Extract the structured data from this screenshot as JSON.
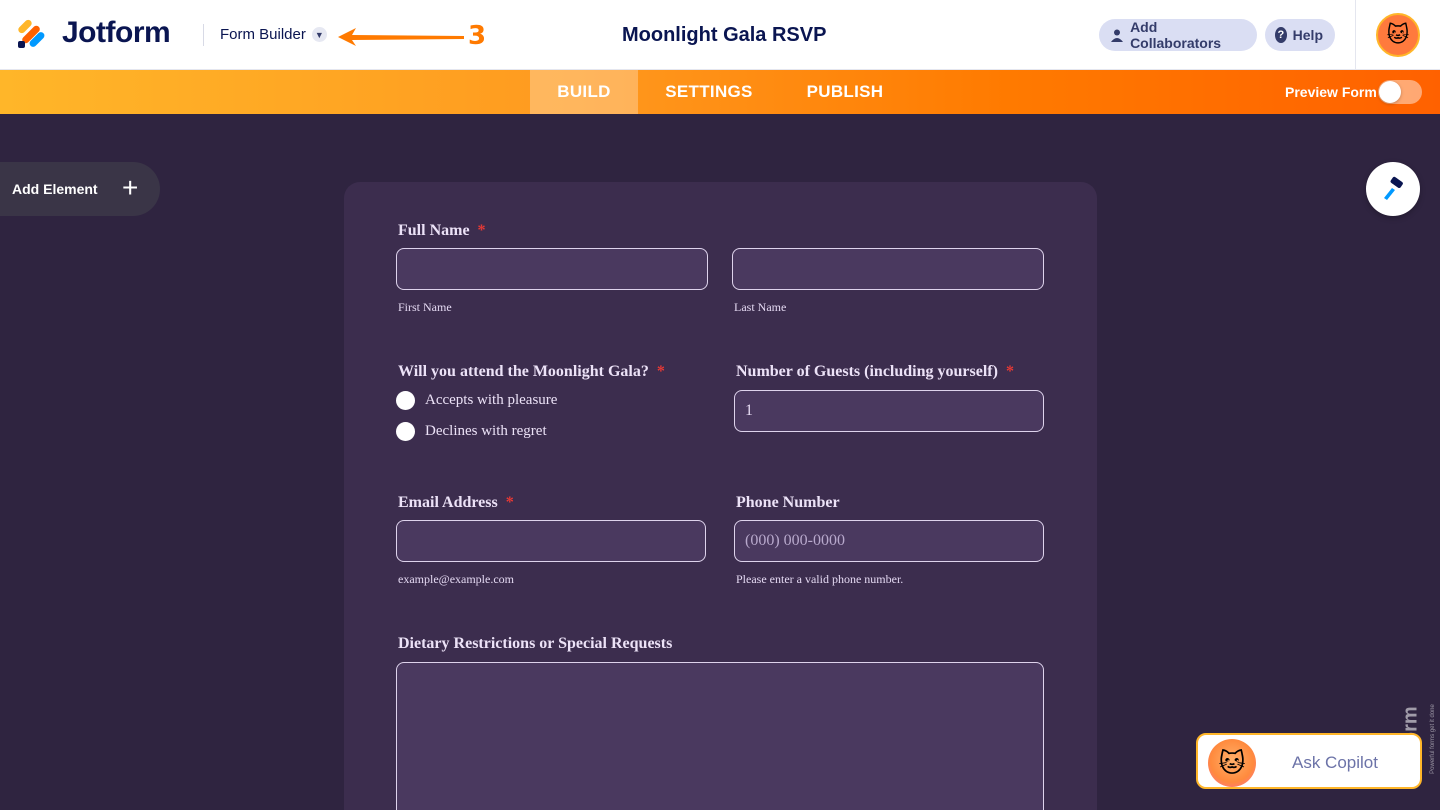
{
  "header": {
    "logo_text": "Jotform",
    "builder_label": "Form Builder",
    "step_number": "3",
    "form_title": "Moonlight Gala RSVP",
    "add_collaborators": "Add Collaborators",
    "help": "Help"
  },
  "tabs": {
    "build": "BUILD",
    "settings": "SETTINGS",
    "publish": "PUBLISH",
    "preview_label": "Preview Form",
    "preview_enabled": false
  },
  "sidebar": {
    "add_element": "Add Element"
  },
  "form": {
    "full_name": {
      "label": "Full Name",
      "required": "*",
      "first_sub": "First Name",
      "last_sub": "Last Name"
    },
    "attend": {
      "label": "Will you attend the Moonlight Gala?",
      "required": "*",
      "options": [
        "Accepts with pleasure",
        "Declines with regret"
      ]
    },
    "guests": {
      "label": "Number of Guests (including yourself)",
      "required": "*",
      "value": "1"
    },
    "email": {
      "label": "Email Address",
      "required": "*",
      "sub": "example@example.com"
    },
    "phone": {
      "label": "Phone Number",
      "placeholder": "(000) 000-0000",
      "sub": "Please enter a valid phone number."
    },
    "dietary": {
      "label": "Dietary Restrictions or Special Requests"
    }
  },
  "watermark": {
    "brand": "Jotform",
    "tagline": "Powerful forms get it done"
  },
  "copilot": {
    "label": "Ask Copilot"
  },
  "colors": {
    "brand_orange": "#ff6100",
    "navy": "#0a1551",
    "canvas": "#2f2440",
    "card": "#3c2d4e"
  }
}
